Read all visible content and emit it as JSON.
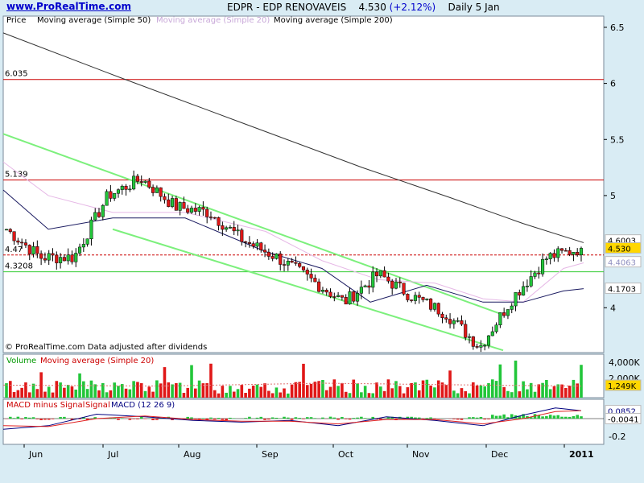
{
  "site": {
    "name": "www.ProRealTime.com"
  },
  "header": {
    "symbol": "EDPR - EDP RENOVAVEIS",
    "last": "4.530",
    "change": "(+2.12%)",
    "period": "Daily",
    "date": "5 Jan"
  },
  "price_panel": {
    "legend": [
      "Price",
      "Moving average (Simple 50)",
      "Moving average (Simple 20)",
      "Moving average (Simple 200)"
    ],
    "footer": "© ProRealTime.com  Data adjusted after dividends",
    "yticks": [
      "6.5",
      "6",
      "5.5",
      "5",
      "4"
    ],
    "hlines": [
      {
        "label": "6.035",
        "value": 6.035
      },
      {
        "label": "5.139",
        "value": 5.139
      },
      {
        "label": "4.3208",
        "value": 4.3208
      },
      {
        "label": "4.47",
        "value": 4.47
      }
    ],
    "right_labels": [
      "4.6003",
      "4.530",
      "4.4063",
      "4.1703"
    ]
  },
  "volume_panel": {
    "legend": [
      "Volume",
      "Moving average (Simple 20)"
    ],
    "yticks": [
      "4,000K",
      "2,000K"
    ],
    "last_label": "1,249K"
  },
  "macd_panel": {
    "legend": [
      "MACD minus Signal",
      "Signal",
      "MACD (12 26 9)"
    ],
    "yticks": [
      "-0.2"
    ],
    "right_labels": [
      "0.0852",
      "-0.0041"
    ]
  },
  "xaxis": {
    "labels": [
      "Jun",
      "Jul",
      "Aug",
      "Sep",
      "Oct",
      "Nov",
      "Dec",
      "2011"
    ]
  },
  "colors": {
    "up": "#22c63a",
    "down": "#e01818",
    "channel": "#7cf07c",
    "ma50": "#000000",
    "ma20": "#e6b8e6",
    "ma200": "#333333",
    "resistance": "#cc0000",
    "support": "#33cc33",
    "macd": "#000080",
    "signal": "#e02020"
  },
  "chart_data": [
    {
      "type": "candlestick",
      "title": "EDPR - EDP RENOVAVEIS 4.530 (+2.12%) Daily 5 Jan",
      "ylim": [
        3.6,
        6.6
      ],
      "ohlc_key_points": [
        {
          "x": "Jun (start)",
          "close": 4.7
        },
        {
          "x": "early Jun",
          "close": 4.45
        },
        {
          "x": "mid Jun",
          "close": 4.45
        },
        {
          "x": "late Jun",
          "close": 5.0
        },
        {
          "x": "early Jul",
          "close": 5.15
        },
        {
          "x": "mid Jul",
          "close": 4.9
        },
        {
          "x": "Aug",
          "close": 4.85
        },
        {
          "x": "mid Aug",
          "close": 4.6
        },
        {
          "x": "Sep",
          "close": 4.45
        },
        {
          "x": "late Sep",
          "close": 4.25
        },
        {
          "x": "Oct",
          "close": 4.05
        },
        {
          "x": "late Oct",
          "close": 4.3
        },
        {
          "x": "Nov",
          "close": 4.1
        },
        {
          "x": "late Nov",
          "close": 3.95
        },
        {
          "x": "end Nov",
          "close": 3.65
        },
        {
          "x": "Dec",
          "close": 4.1
        },
        {
          "x": "mid Dec",
          "close": 4.45
        },
        {
          "x": "2011",
          "close": 4.53
        }
      ],
      "series": [
        {
          "name": "Moving average (Simple 50)"
        },
        {
          "name": "Moving average (Simple 20)"
        },
        {
          "name": "Moving average (Simple 200)"
        }
      ]
    },
    {
      "type": "bar",
      "title": "Volume",
      "ylim": [
        0,
        4000
      ],
      "yunit": "K",
      "last_value": 1249
    },
    {
      "type": "bar+line",
      "title": "MACD (12 26 9)",
      "last_macd": 0.0852,
      "last_signal": -0.0041
    }
  ]
}
